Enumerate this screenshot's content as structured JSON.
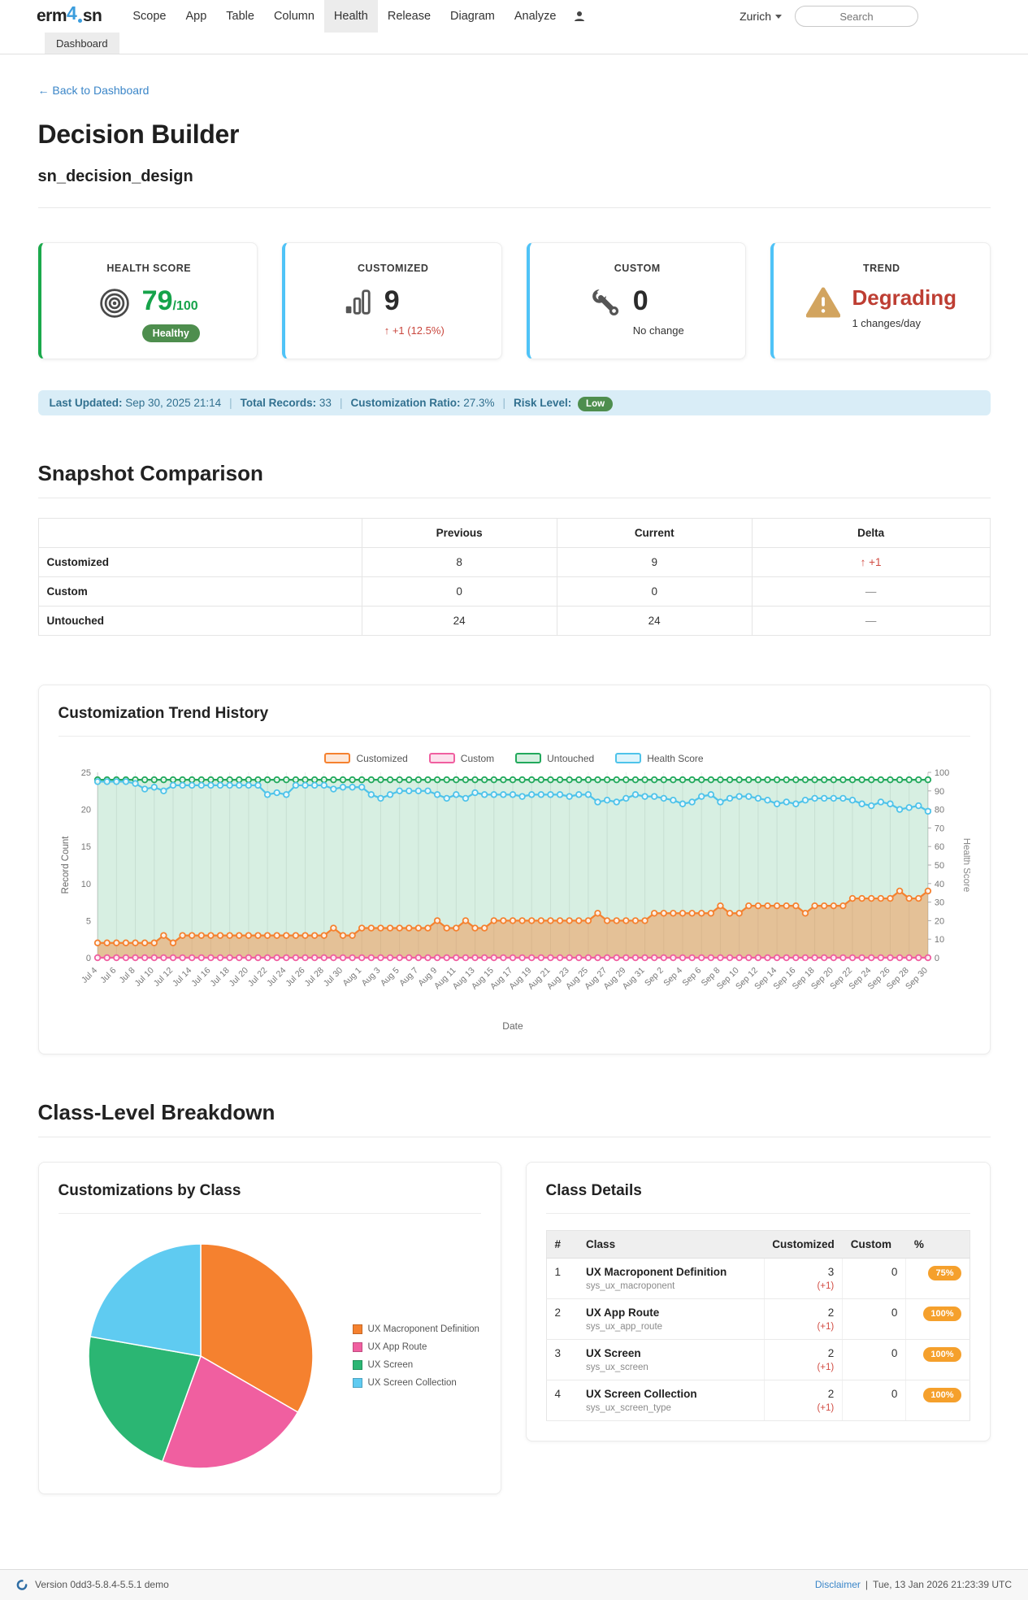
{
  "header": {
    "logo": {
      "pre": "erm",
      "num": "4",
      "post": "sn"
    },
    "nav": [
      {
        "label": "Scope",
        "active": false
      },
      {
        "label": "App",
        "active": false
      },
      {
        "label": "Table",
        "active": false
      },
      {
        "label": "Column",
        "active": false
      },
      {
        "label": "Health",
        "active": true
      },
      {
        "label": "Release",
        "active": false
      },
      {
        "label": "Diagram",
        "active": false
      },
      {
        "label": "Analyze",
        "active": false
      }
    ],
    "region": "Zurich",
    "search_placeholder": "Search"
  },
  "subnav": {
    "tab": "Dashboard"
  },
  "page": {
    "back_link": "← Back to Dashboard",
    "title": "Decision Builder",
    "subtitle": "sn_decision_design"
  },
  "cards": [
    {
      "label": "HEALTH SCORE",
      "icon": "target-icon",
      "accent": "#1BA94C",
      "value": "79",
      "suffix": "/100",
      "value_color": "#16A34A",
      "badge": "Healthy"
    },
    {
      "label": "CUSTOMIZED",
      "icon": "bar-chart-icon",
      "accent": "#4FC3F7",
      "value": "9",
      "sub": "↑ +1 (12.5%)",
      "sub_red": true
    },
    {
      "label": "CUSTOM",
      "icon": "wrench-icon",
      "accent": "#4FC3F7",
      "value": "0",
      "sub": "No change",
      "sub_red": false
    },
    {
      "label": "TREND",
      "icon": "warning-icon",
      "accent": "#4FC3F7",
      "value": "Degrading",
      "value_color": "#BE3E33",
      "trend_style": true,
      "sub": "1 changes/day",
      "sub_red": false
    }
  ],
  "info_bar": {
    "separator": "|",
    "items": [
      {
        "label": "Last Updated:",
        "value": "Sep 30, 2025 21:14"
      },
      {
        "label": "Total Records:",
        "value": "33"
      },
      {
        "label": "Customization Ratio:",
        "value": "27.3%"
      },
      {
        "label": "Risk Level:",
        "badge": "Low"
      }
    ]
  },
  "snapshot": {
    "title": "Snapshot Comparison",
    "columns": [
      "",
      "Previous",
      "Current",
      "Delta"
    ],
    "rows": [
      {
        "label": "Customized",
        "previous": "8",
        "current": "9",
        "delta": "↑ +1",
        "delta_red": true
      },
      {
        "label": "Custom",
        "previous": "0",
        "current": "0",
        "delta": "—",
        "delta_red": false
      },
      {
        "label": "Untouched",
        "previous": "24",
        "current": "24",
        "delta": "—",
        "delta_red": false
      }
    ]
  },
  "trend": {
    "title": "Customization Trend History"
  },
  "breakdown": {
    "title": "Class-Level Breakdown",
    "pie_title": "Customizations by Class",
    "details_title": "Class Details",
    "table": {
      "columns": [
        "#",
        "Class",
        "Customized",
        "Custom",
        "%"
      ],
      "rows": [
        {
          "num": "1",
          "class": "UX Macroponent Definition",
          "sys": "sys_ux_macroponent",
          "customized": "3",
          "change": "(+1)",
          "custom": "0",
          "pct": "75%"
        },
        {
          "num": "2",
          "class": "UX App Route",
          "sys": "sys_ux_app_route",
          "customized": "2",
          "change": "(+1)",
          "custom": "0",
          "pct": "100%"
        },
        {
          "num": "3",
          "class": "UX Screen",
          "sys": "sys_ux_screen",
          "customized": "2",
          "change": "(+1)",
          "custom": "0",
          "pct": "100%"
        },
        {
          "num": "4",
          "class": "UX Screen Collection",
          "sys": "sys_ux_screen_type",
          "customized": "2",
          "change": "(+1)",
          "custom": "0",
          "pct": "100%"
        }
      ]
    }
  },
  "footer": {
    "version": "Version 0dd3-5.8.4-5.5.1 demo",
    "disclaimer": "Disclaimer",
    "separator": "|",
    "timestamp": "Tue, 13 Jan 2026 21:23:39 UTC"
  },
  "colors": {
    "accent_green": "#1BA94C",
    "accent_blue": "#4FC3F7",
    "health_green": "#16A34A",
    "healthy_badge": "#4E8E4E",
    "degrading_red": "#BE3E33",
    "delta_red": "#D14B42",
    "info_bg": "#D9EDF7",
    "info_text": "#31708F",
    "low_badge": "#4E8E4E",
    "pct_badge": "#F5A02C",
    "link_blue": "#3B86C8",
    "customized_orange": "#F5812F",
    "custom_pink": "#F05FA0",
    "untouched_green": "#22A95C",
    "health_blue": "#4EC3EA"
  },
  "chart_data": [
    {
      "type": "line",
      "title": "Customization Trend History",
      "xlabel": "Date",
      "ylabel_left": "Record Count",
      "ylabel_right": "Health Score",
      "ylim_left": [
        0,
        25
      ],
      "ylim_right": [
        0,
        100
      ],
      "legend_position": "top",
      "grid": "vertical",
      "x": [
        "Jul 4",
        "Jul 5",
        "Jul 6",
        "Jul 7",
        "Jul 8",
        "Jul 9",
        "Jul 10",
        "Jul 11",
        "Jul 12",
        "Jul 13",
        "Jul 14",
        "Jul 15",
        "Jul 16",
        "Jul 17",
        "Jul 18",
        "Jul 19",
        "Jul 20",
        "Jul 21",
        "Jul 22",
        "Jul 23",
        "Jul 24",
        "Jul 25",
        "Jul 26",
        "Jul 27",
        "Jul 28",
        "Jul 29",
        "Jul 30",
        "Jul 31",
        "Aug 1",
        "Aug 2",
        "Aug 3",
        "Aug 4",
        "Aug 5",
        "Aug 6",
        "Aug 7",
        "Aug 8",
        "Aug 9",
        "Aug 10",
        "Aug 11",
        "Aug 12",
        "Aug 13",
        "Aug 14",
        "Aug 15",
        "Aug 16",
        "Aug 17",
        "Aug 18",
        "Aug 19",
        "Aug 20",
        "Aug 21",
        "Aug 22",
        "Aug 23",
        "Aug 24",
        "Aug 25",
        "Aug 26",
        "Aug 27",
        "Aug 28",
        "Aug 29",
        "Aug 30",
        "Aug 31",
        "Sep 1",
        "Sep 2",
        "Sep 3",
        "Sep 4",
        "Sep 5",
        "Sep 6",
        "Sep 7",
        "Sep 8",
        "Sep 9",
        "Sep 10",
        "Sep 11",
        "Sep 12",
        "Sep 13",
        "Sep 14",
        "Sep 15",
        "Sep 16",
        "Sep 17",
        "Sep 18",
        "Sep 19",
        "Sep 20",
        "Sep 21",
        "Sep 22",
        "Sep 23",
        "Sep 24",
        "Sep 25",
        "Sep 26",
        "Sep 27",
        "Sep 28",
        "Sep 29",
        "Sep 30"
      ],
      "tick_every": 2,
      "series": [
        {
          "name": "Customized",
          "axis": "left",
          "color": "#F5812F",
          "fill": "rgba(245,129,47,0.42)",
          "values": [
            2,
            2,
            2,
            2,
            2,
            2,
            2,
            3,
            2,
            3,
            3,
            3,
            3,
            3,
            3,
            3,
            3,
            3,
            3,
            3,
            3,
            3,
            3,
            3,
            3,
            4,
            3,
            3,
            4,
            4,
            4,
            4,
            4,
            4,
            4,
            4,
            5,
            4,
            4,
            5,
            4,
            4,
            5,
            5,
            5,
            5,
            5,
            5,
            5,
            5,
            5,
            5,
            5,
            6,
            5,
            5,
            5,
            5,
            5,
            6,
            6,
            6,
            6,
            6,
            6,
            6,
            7,
            6,
            6,
            7,
            7,
            7,
            7,
            7,
            7,
            6,
            7,
            7,
            7,
            7,
            8,
            8,
            8,
            8,
            8,
            9,
            8,
            8,
            9
          ]
        },
        {
          "name": "Custom",
          "axis": "left",
          "color": "#F05FA0",
          "fill": null,
          "values": [
            0,
            0,
            0,
            0,
            0,
            0,
            0,
            0,
            0,
            0,
            0,
            0,
            0,
            0,
            0,
            0,
            0,
            0,
            0,
            0,
            0,
            0,
            0,
            0,
            0,
            0,
            0,
            0,
            0,
            0,
            0,
            0,
            0,
            0,
            0,
            0,
            0,
            0,
            0,
            0,
            0,
            0,
            0,
            0,
            0,
            0,
            0,
            0,
            0,
            0,
            0,
            0,
            0,
            0,
            0,
            0,
            0,
            0,
            0,
            0,
            0,
            0,
            0,
            0,
            0,
            0,
            0,
            0,
            0,
            0,
            0,
            0,
            0,
            0,
            0,
            0,
            0,
            0,
            0,
            0,
            0,
            0,
            0,
            0,
            0,
            0,
            0,
            0,
            0
          ]
        },
        {
          "name": "Untouched",
          "axis": "left",
          "color": "#22A95C",
          "fill": "rgba(34,169,92,0.18)",
          "values": [
            24,
            24,
            24,
            24,
            24,
            24,
            24,
            24,
            24,
            24,
            24,
            24,
            24,
            24,
            24,
            24,
            24,
            24,
            24,
            24,
            24,
            24,
            24,
            24,
            24,
            24,
            24,
            24,
            24,
            24,
            24,
            24,
            24,
            24,
            24,
            24,
            24,
            24,
            24,
            24,
            24,
            24,
            24,
            24,
            24,
            24,
            24,
            24,
            24,
            24,
            24,
            24,
            24,
            24,
            24,
            24,
            24,
            24,
            24,
            24,
            24,
            24,
            24,
            24,
            24,
            24,
            24,
            24,
            24,
            24,
            24,
            24,
            24,
            24,
            24,
            24,
            24,
            24,
            24,
            24,
            24,
            24,
            24,
            24,
            24,
            24,
            24,
            24,
            24
          ]
        },
        {
          "name": "Health Score",
          "axis": "right",
          "color": "#4EC3EA",
          "fill": null,
          "values": [
            95,
            95,
            95,
            95,
            94,
            91,
            92,
            90,
            93,
            93,
            93,
            93,
            93,
            93,
            93,
            93,
            93,
            93,
            88,
            89,
            88,
            93,
            93,
            93,
            93,
            91,
            92,
            92,
            92,
            88,
            86,
            88,
            90,
            90,
            90,
            90,
            88,
            86,
            88,
            86,
            89,
            88,
            88,
            88,
            88,
            87,
            88,
            88,
            88,
            88,
            87,
            88,
            88,
            84,
            85,
            84,
            86,
            88,
            87,
            87,
            86,
            85,
            83,
            84,
            87,
            88,
            84,
            86,
            87,
            87,
            86,
            85,
            83,
            84,
            83,
            85,
            86,
            86,
            86,
            86,
            85,
            83,
            82,
            84,
            83,
            80,
            81,
            82,
            79
          ]
        }
      ]
    },
    {
      "type": "pie",
      "title": "Customizations by Class",
      "labels": [
        "UX Macroponent Definition",
        "UX App Route",
        "UX Screen",
        "UX Screen Collection"
      ],
      "values": [
        3,
        2,
        2,
        2
      ],
      "colors": [
        "#F5812F",
        "#F05FA0",
        "#2BB673",
        "#5FCBF1"
      ],
      "legend_position": "right"
    }
  ]
}
